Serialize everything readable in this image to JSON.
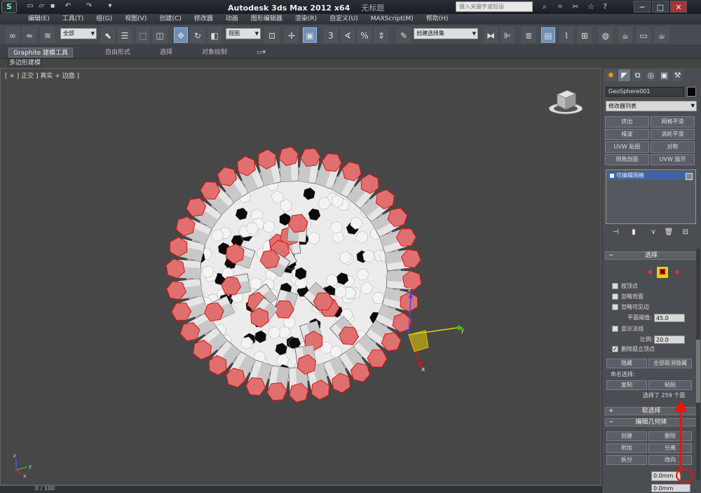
{
  "title_bar": {
    "app_title": "Autodesk 3ds Max  2012 x64",
    "doc_title": "无标题",
    "search_placeholder": "键入关键字或短语",
    "quick_access_icons": [
      "new-file-icon",
      "open-folder-icon",
      "save-icon",
      "undo-icon",
      "redo-icon",
      "dropdown-icon"
    ],
    "window_buttons": [
      "─",
      "□",
      "✕"
    ]
  },
  "menu": [
    "编辑(E)",
    "工具(T)",
    "组(G)",
    "视图(V)",
    "创建(C)",
    "修改器",
    "动画",
    "图形编辑器",
    "渲染(R)",
    "自定义(U)",
    "MAXScript(M)",
    "帮助(H)"
  ],
  "toolbar": {
    "selection_filter": "全部",
    "ref_coord": "视图",
    "named_selection": "创建选择集",
    "snap_label": "3",
    "percent_label": "%",
    "active_tool_color": "#6f8eb8"
  },
  "ribbon": {
    "tabs": [
      "Graphite 建模工具",
      "自由形式",
      "选择",
      "对象绘制"
    ],
    "active_tab": "Graphite 建模工具",
    "subtab": "多边形建模"
  },
  "viewport": {
    "label": "[ + ] 正交 ] 真实 + 边面 ]",
    "object_colors": {
      "body": "#ececec",
      "dark": "#0a0a0a",
      "selected_faces": "#e07070",
      "edges": "#d11"
    },
    "axis_labels": {
      "x": "x",
      "y": "y",
      "z": "z"
    },
    "corner_axis": {
      "x": "x",
      "y": "y",
      "z": "z"
    }
  },
  "timeline": {
    "frames": "0 / 100"
  },
  "command_panel": {
    "object_name": "GeoSphere001",
    "modifier_list": "修改器列表",
    "modifier_buttons": [
      "挤出",
      "网格平滑",
      "噪波",
      "涡轮平滑",
      "UVW 贴图",
      "对称",
      "倒角剖面",
      "UVW 展开"
    ],
    "stack_item": "可编辑网格",
    "selection_rollout": {
      "title": "选择",
      "by_vertex": "按顶点",
      "ignore_backface": "忽略背面",
      "ignore_visible_edges": "忽略可见边",
      "planar_threshold_label": "平面阈值:",
      "planar_threshold_value": "45.0",
      "show_normals": "显示法线",
      "scale_label": "比例:",
      "scale_value": "20.0",
      "delete_isolated": "删除孤立顶点",
      "delete_isolated_checked": true,
      "hide_btn": "隐藏",
      "unhide_btn": "全部取消隐藏",
      "named_sel_label": "命名选择:",
      "copy_btn": "复制",
      "paste_btn": "粘贴",
      "status": "选择了 259 个面"
    },
    "soft_selection": "软选择",
    "edit_geometry": {
      "title": "编辑几何体",
      "create_btn": "创建",
      "delete_btn": "删除",
      "attach_btn": "附加",
      "detach_btn": "分离",
      "divide_btn": "拆分",
      "turn_btn": "改向",
      "extrude_value": "0.0mm",
      "bottom_value": "0.0mm"
    },
    "annotation_color": "#e11"
  }
}
